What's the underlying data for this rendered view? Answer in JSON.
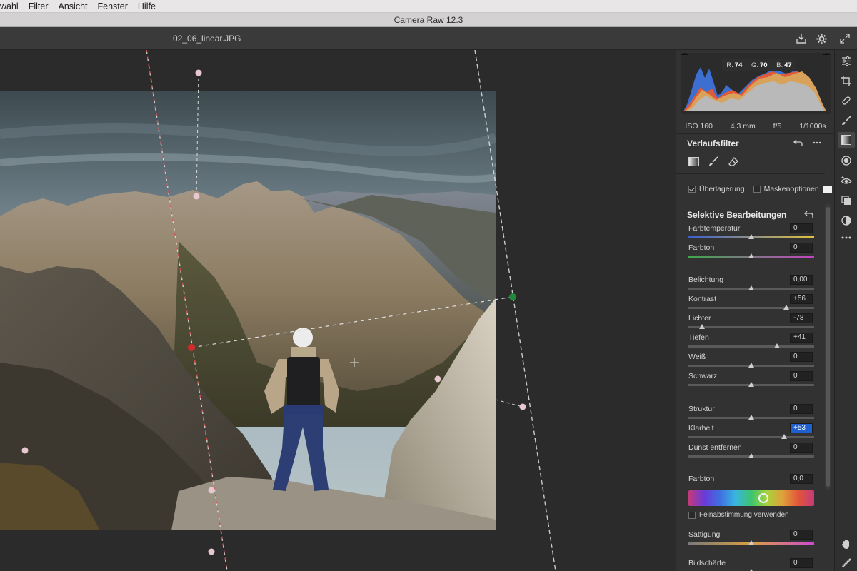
{
  "menu": [
    "wahl",
    "Filter",
    "Ansicht",
    "Fenster",
    "Hilfe"
  ],
  "window_title": "Camera Raw 12.3",
  "file_name": "02_06_linear.JPG",
  "histogram": {
    "r_label": "R:",
    "r": "74",
    "g_label": "G:",
    "g": "70",
    "b_label": "B:",
    "b": "47"
  },
  "exif": {
    "iso": "ISO 160",
    "focal": "4,3 mm",
    "aperture": "f/5",
    "shutter": "1/1000s"
  },
  "filter_section": {
    "title": "Verlaufsfilter",
    "overlay_label": "Überlagerung",
    "overlay_checked": true,
    "mask_label": "Maskenoptionen",
    "mask_checked": false
  },
  "selective": {
    "title": "Selektive Bearbeitungen",
    "sliders": [
      {
        "label": "Farbtemperatur",
        "value": "0",
        "pos": 0.5
      },
      {
        "label": "Farbton",
        "value": "0",
        "pos": 0.5
      },
      {
        "label": "Belichtung",
        "value": "0,00",
        "pos": 0.5
      },
      {
        "label": "Kontrast",
        "value": "+56",
        "pos": 0.78
      },
      {
        "label": "Lichter",
        "value": "-78",
        "pos": 0.11
      },
      {
        "label": "Tiefen",
        "value": "+41",
        "pos": 0.705
      },
      {
        "label": "Weiß",
        "value": "0",
        "pos": 0.5
      },
      {
        "label": "Schwarz",
        "value": "0",
        "pos": 0.5
      },
      {
        "label": "Struktur",
        "value": "0",
        "pos": 0.5
      },
      {
        "label": "Klarheit",
        "value": "+53",
        "pos": 0.765
      },
      {
        "label": "Dunst entfernen",
        "value": "0",
        "pos": 0.5
      },
      {
        "label": "Farbton",
        "value": "0,0",
        "pos": 0.5
      },
      {
        "label": "Sättigung",
        "value": "0",
        "pos": 0.5
      },
      {
        "label": "Bildschärfe",
        "value": "0",
        "pos": 0.5
      }
    ],
    "fine_tune_label": "Feinabstimmung verwenden",
    "fine_tune_checked": false,
    "hue_position": 0.5
  },
  "colors": {
    "panel_bg": "#323232",
    "canvas_bg": "#2b2b2b",
    "selected_field": "#1f5fcf"
  },
  "tools": [
    "sliders-icon",
    "crop-icon",
    "healing-icon",
    "brush-icon",
    "graduated-filter-icon",
    "radial-filter-icon",
    "redeye-icon",
    "snapshots-icon",
    "presets-icon",
    "more-icon",
    "hand-icon",
    "color-sampler-icon"
  ]
}
